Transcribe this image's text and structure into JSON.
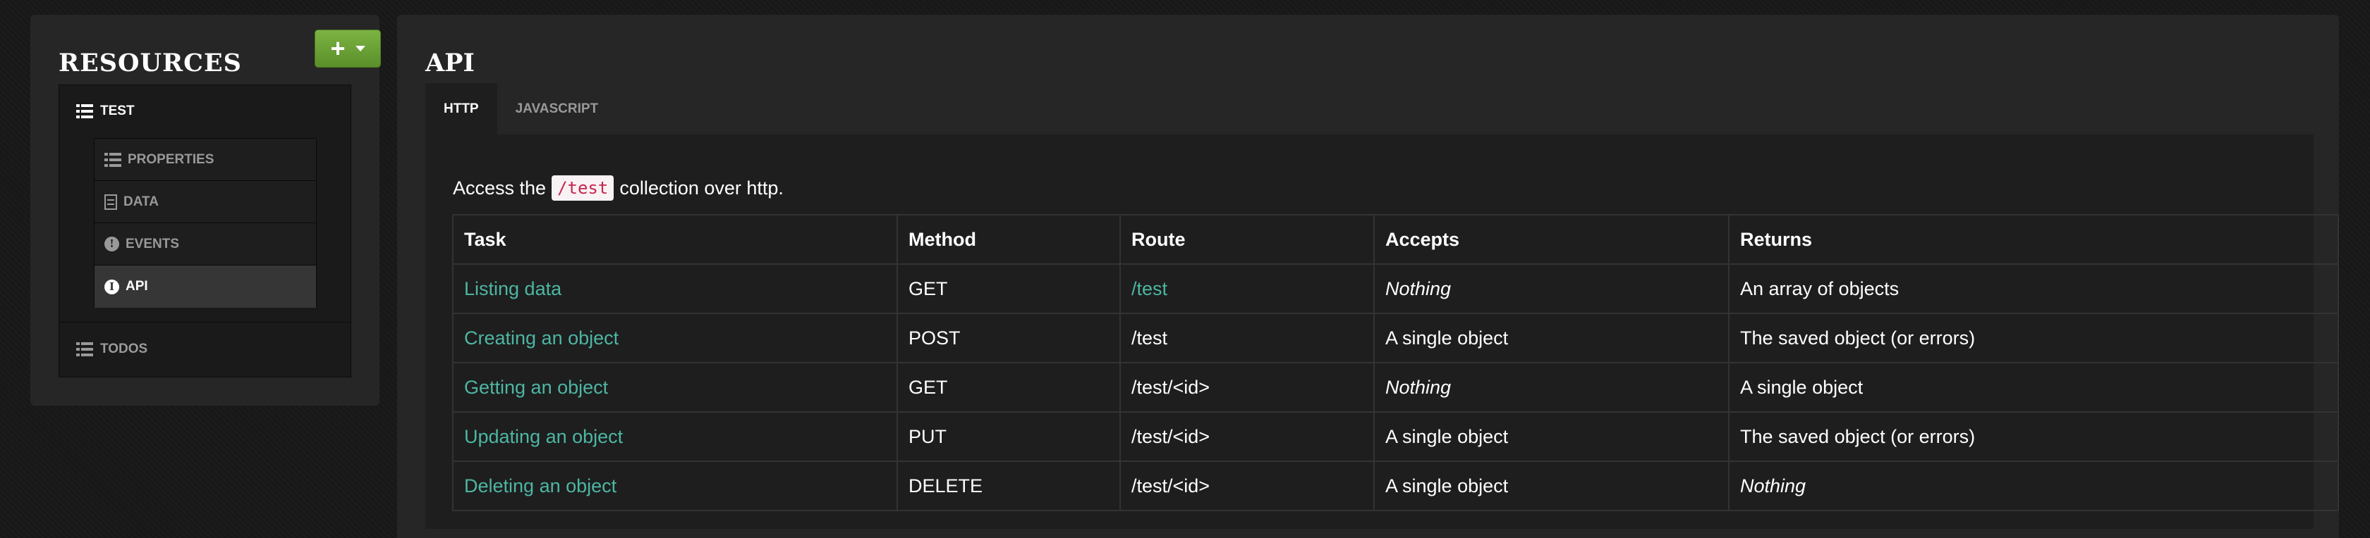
{
  "sidebar": {
    "title": "RESOURCES",
    "add_button": {
      "icon": "plus-icon"
    },
    "resources": [
      {
        "label": "TEST",
        "icon": "list-icon",
        "children": [
          {
            "label": "PROPERTIES",
            "icon": "list-icon",
            "active": false
          },
          {
            "label": "DATA",
            "icon": "document-icon",
            "active": false
          },
          {
            "label": "EVENTS",
            "icon": "exclamation-circle-icon",
            "active": false
          },
          {
            "label": "API",
            "icon": "info-circle-icon",
            "active": true
          }
        ]
      },
      {
        "label": "TODOS",
        "icon": "list-icon"
      }
    ]
  },
  "main": {
    "title": "API",
    "tabs": [
      {
        "label": "HTTP",
        "active": true
      },
      {
        "label": "JAVASCRIPT",
        "active": false
      }
    ],
    "intro": {
      "before": "Access the",
      "code": "/test",
      "after": "collection over http."
    },
    "table": {
      "headers": [
        "Task",
        "Method",
        "Route",
        "Accepts",
        "Returns"
      ],
      "rows": [
        {
          "task": "Listing data",
          "method": "GET",
          "route": "/test",
          "accepts": "Nothing",
          "returns": "An array of objects"
        },
        {
          "task": "Creating an object",
          "method": "POST",
          "route": "/test",
          "accepts": "A single object",
          "returns": "The saved object (or errors)"
        },
        {
          "task": "Getting an object",
          "method": "GET",
          "route": "/test/<id>",
          "accepts": "Nothing",
          "returns": "A single object"
        },
        {
          "task": "Updating an object",
          "method": "PUT",
          "route": "/test/<id>",
          "accepts": "A single object",
          "returns": "The saved object (or errors)"
        },
        {
          "task": "Deleting an object",
          "method": "DELETE",
          "route": "/test/<id>",
          "accepts": "A single object",
          "returns": "Nothing"
        }
      ]
    }
  },
  "colors": {
    "link": "#4db6a3",
    "add_button": "#6aa233",
    "code_text": "#c7254e",
    "code_bg": "#f9f2f4"
  }
}
